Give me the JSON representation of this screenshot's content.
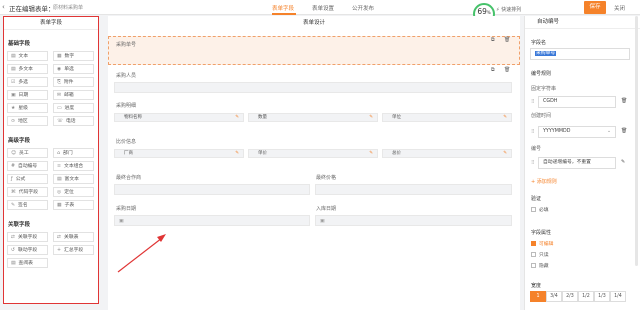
{
  "header": {
    "back_icon": "‹",
    "title": "正在编辑表单：",
    "subtitle": "原材料采购单",
    "tabs": [
      "表单字段",
      "表单设置",
      "公开发布"
    ],
    "progress_value": "69",
    "progress_unit": "%",
    "progress_label": "完成度",
    "fast_label": "快速排列",
    "save_label": "保存",
    "close_label": "关闭"
  },
  "palette": {
    "title": "表单字段",
    "groups": [
      {
        "name": "基础字段",
        "items": [
          {
            "icon": "▤",
            "label": "文本"
          },
          {
            "icon": "▦",
            "label": "数字"
          },
          {
            "icon": "▤",
            "label": "多文本"
          },
          {
            "icon": "◉",
            "label": "单选"
          },
          {
            "icon": "☑",
            "label": "多选"
          },
          {
            "icon": "⎘",
            "label": "附件"
          },
          {
            "icon": "▣",
            "label": "日期"
          },
          {
            "icon": "✉",
            "label": "邮箱"
          },
          {
            "icon": "★",
            "label": "星级"
          },
          {
            "icon": "▭",
            "label": "进度"
          },
          {
            "icon": "⊙",
            "label": "地区"
          },
          {
            "icon": "☏",
            "label": "电话"
          }
        ]
      },
      {
        "name": "高级字段",
        "items": [
          {
            "icon": "☺",
            "label": "员工"
          },
          {
            "icon": "⌂",
            "label": "部门"
          },
          {
            "icon": "#",
            "label": "自动编号"
          },
          {
            "icon": "≡",
            "label": "文本组合"
          },
          {
            "icon": "ƒ",
            "label": "公式"
          },
          {
            "icon": "▤",
            "label": "富文本"
          },
          {
            "icon": "⌘",
            "label": "代码字段"
          },
          {
            "icon": "◎",
            "label": "定位"
          },
          {
            "icon": "✎",
            "label": "签名"
          },
          {
            "icon": "▦",
            "label": "子表"
          }
        ]
      },
      {
        "name": "关联字段",
        "items": [
          {
            "icon": "⇄",
            "label": "关联字段"
          },
          {
            "icon": "⇄",
            "label": "关联表"
          },
          {
            "icon": "↺",
            "label": "联动字段"
          },
          {
            "icon": "+",
            "label": "汇总字段"
          },
          {
            "icon": "▤",
            "label": "查阅表"
          }
        ]
      }
    ]
  },
  "canvas": {
    "title": "表单设计",
    "purchase_no_label": "采购单号",
    "purchaser_label": "采购人员",
    "material_label": "采购明细",
    "material_cols": [
      "物料名称",
      "数量",
      "单位"
    ],
    "supplier_label": "比价信息",
    "supplier_cols": [
      "厂商",
      "单价",
      "总价"
    ],
    "last_supplier_label": "最终合作商",
    "last_price_label": "最终价格",
    "purchase_date_label": "采购日期",
    "store_date_label": "入库日期"
  },
  "props": {
    "title": "自动编号",
    "field_name_label": "字段名",
    "field_name_value": "采购单号",
    "rule_label": "编号规则",
    "fixed_label": "固定字符串",
    "fixed_value": "CGDH",
    "date_label": "创建时间",
    "date_value": "YYYYMMDD",
    "seq_label": "编号",
    "seq_value": "自动递增编号，不重置",
    "add_rule": "添加规则",
    "verify_label": "验证",
    "required_label": "必填",
    "attr_label": "字段属性",
    "editable_label": "可编辑",
    "readonly_label": "只读",
    "hidden_label": "隐藏",
    "width_label": "宽度",
    "widths": [
      "1",
      "3/4",
      "2/3",
      "1/2",
      "1/3",
      "1/4"
    ]
  },
  "colors": {
    "accent": "#f5822a",
    "highlight": "#e03535",
    "progress": "#46c26a"
  }
}
